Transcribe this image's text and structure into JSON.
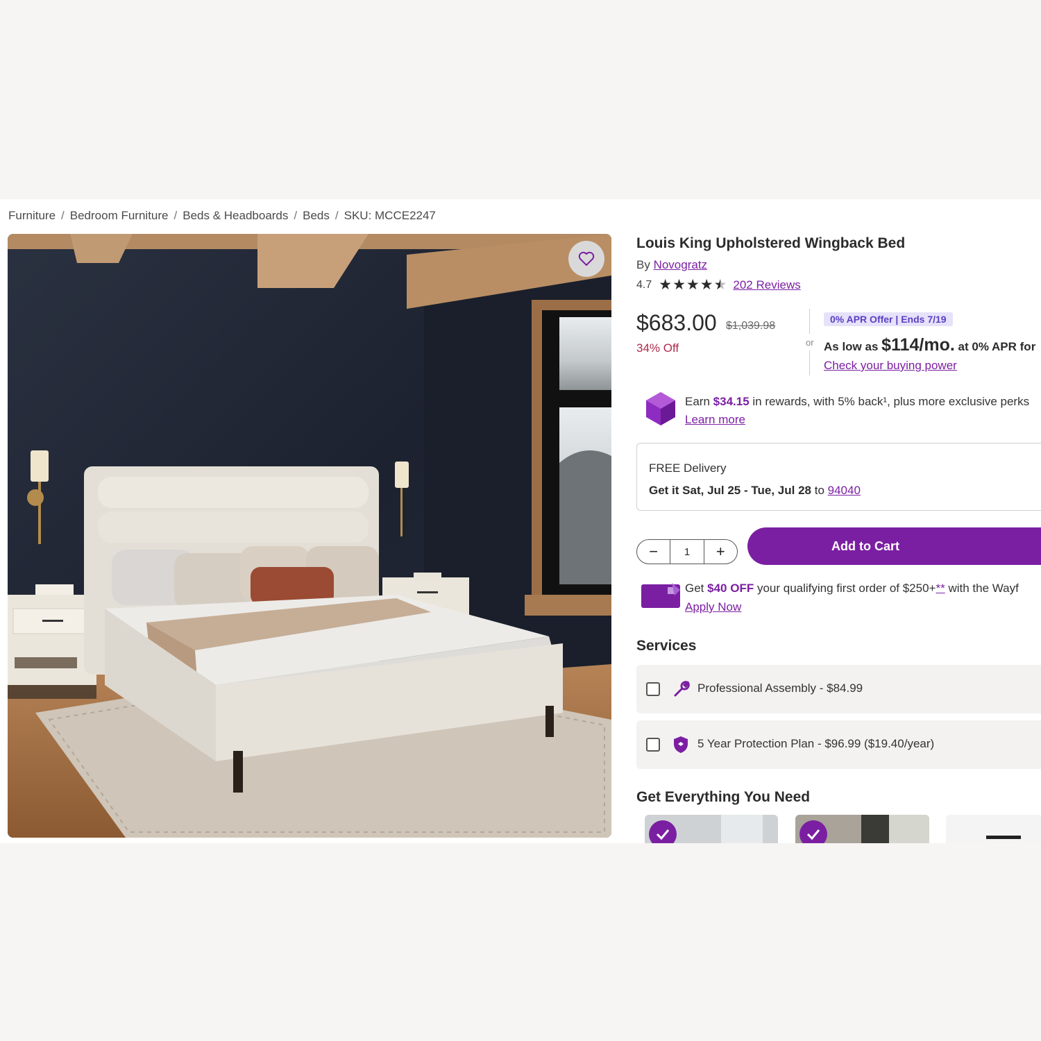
{
  "breadcrumb": {
    "items": [
      "Furniture",
      "Bedroom Furniture",
      "Beds & Headboards",
      "Beds"
    ],
    "sku": "SKU: MCCE2247",
    "separator": "/"
  },
  "product": {
    "title": "Louis King Upholstered Wingback Bed",
    "by_prefix": "By",
    "brand": "Novogratz",
    "rating": "4.7",
    "rating_stars": 4.5,
    "reviews": "202 Reviews"
  },
  "pricing": {
    "price": "$683.00",
    "was_price": "$1,039.98",
    "discount": "34% Off",
    "or_label": "or",
    "apr_badge": "0% APR Offer | Ends 7/19",
    "as_low_prefix": "As low as",
    "monthly": "$114/mo.",
    "as_low_suffix": "at 0% APR for",
    "check_link": "Check your buying power"
  },
  "rewards": {
    "prefix": "Earn",
    "amount": "$34.15",
    "suffix": "in rewards, with 5% back¹, plus more exclusive perks",
    "learn_more": "Learn more"
  },
  "delivery": {
    "title": "FREE Delivery",
    "date_text": "Get it Sat, Jul 25 - Tue, Jul 28",
    "to_label": "to",
    "zip": "94040"
  },
  "cart": {
    "quantity": "1",
    "minus": "−",
    "plus": "+",
    "add_label": "Add to Cart"
  },
  "card_offer": {
    "prefix": "Get",
    "amount": "$40 OFF",
    "middle": "your qualifying first order of $250+",
    "asterisks": "**",
    "suffix": "with the Wayf",
    "apply": "Apply Now"
  },
  "services": {
    "heading": "Services",
    "items": [
      {
        "label": "Professional Assembly - $84.99",
        "icon": "wrench-icon"
      },
      {
        "label": "5 Year Protection Plan - $96.99 ($19.40/year)",
        "icon": "shield-icon"
      }
    ]
  },
  "everything": {
    "heading": "Get Everything You Need"
  },
  "colors": {
    "accent": "#7b1fa2",
    "discount": "#b0284a",
    "badge_bg": "#e6e2fb"
  }
}
